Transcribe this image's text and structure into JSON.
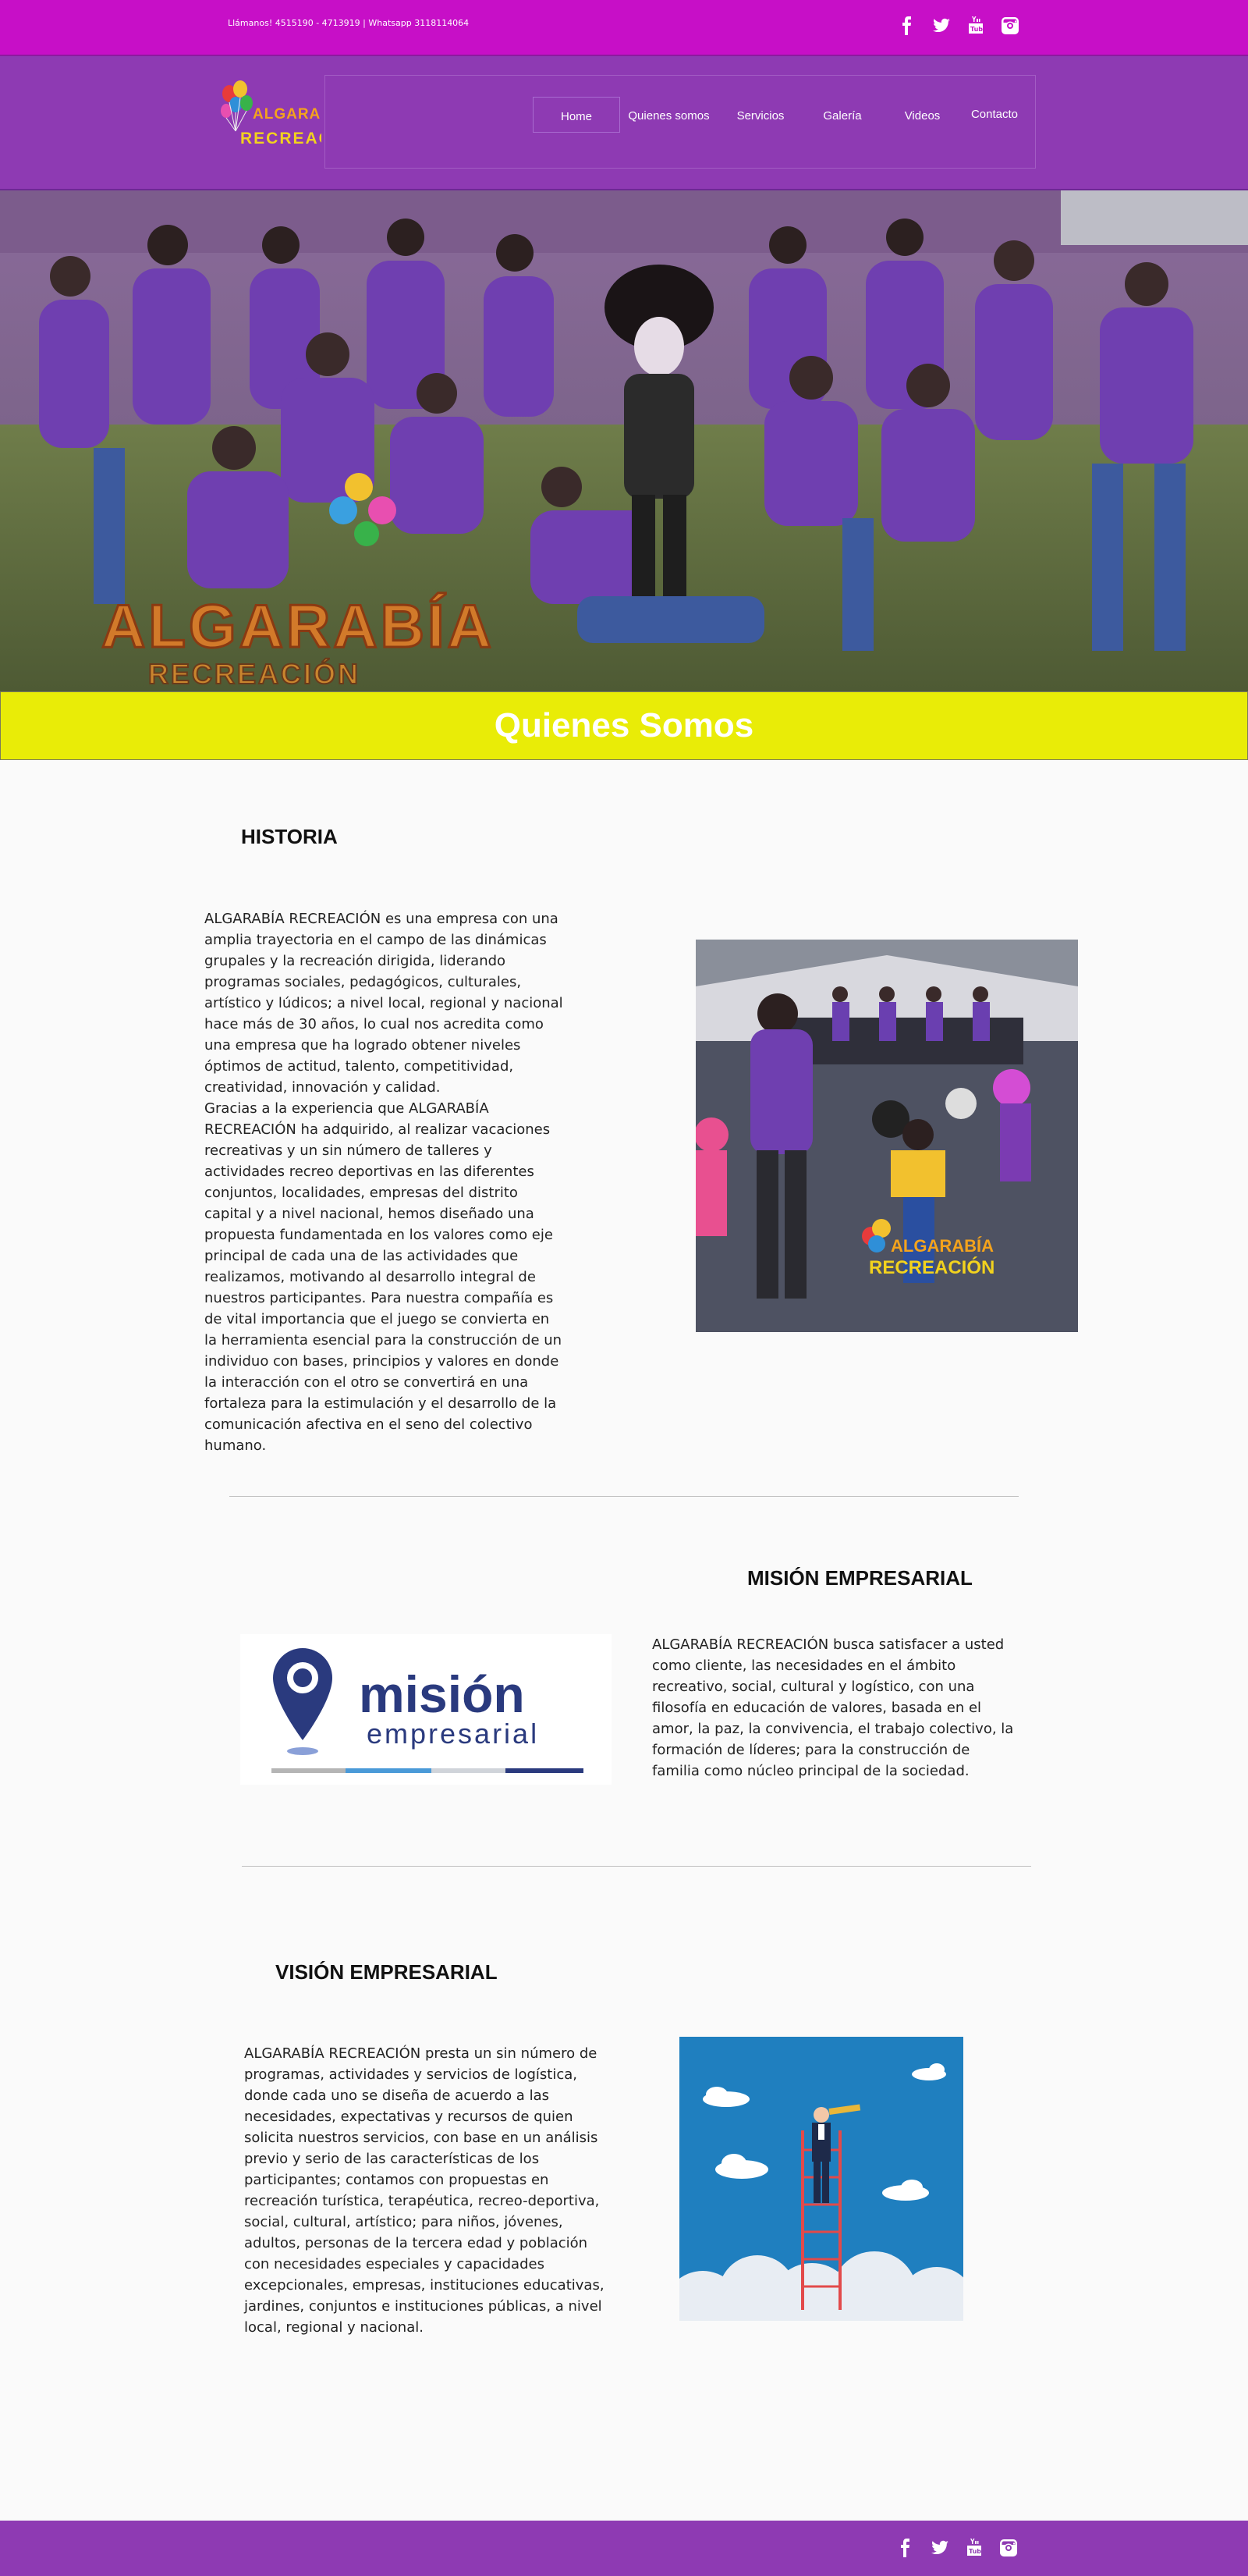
{
  "topbar": {
    "contact": "Llámanos! 4515190 - 4713919 | Whatsapp 3118114064",
    "social": [
      "facebook-icon",
      "twitter-icon",
      "youtube-icon",
      "instagram-icon"
    ]
  },
  "header": {
    "logo_line1": "ALGARABÍA",
    "logo_line2": "RECREACIÓN",
    "nav": [
      "Home",
      "Quienes somos",
      "Servicios",
      "Galería",
      "Videos",
      "Contacto"
    ]
  },
  "hero": {
    "watermark_line1": "ALGARABÍA",
    "watermark_line2": "RECREACIÓN"
  },
  "banner": {
    "title": "Quienes Somos"
  },
  "historia": {
    "title": "HISTORIA",
    "lines": [
      "ALGARABÍA RECREACIÓN es una empresa con una",
      "amplia trayectoria en el campo de las dinámicas",
      "grupales y la recreación dirigida, liderando",
      "programas sociales, pedagógicos, culturales,",
      "artístico y lúdicos; a nivel local, regional y nacional",
      "hace más de 30 años, lo cual nos acredita como",
      "una empresa que ha logrado obtener niveles",
      "óptimos de actitud, talento, competitividad,",
      "creatividad, innovación y calidad.",
      "Gracias a la experiencia que ALGARABÍA",
      "RECREACIÓN ha adquirido, al realizar vacaciones",
      "recreativas y un sin número de talleres y",
      "actividades recreo deportivas en las diferentes",
      "conjuntos, localidades, empresas del distrito",
      "capital y a nivel nacional, hemos diseñado una",
      "propuesta fundamentada en los valores como eje",
      "principal de cada una de las actividades que",
      "realizamos, motivando al desarrollo integral de",
      "nuestros participantes. Para nuestra compañía es",
      "de vital importancia que el juego se convierta en",
      "la herramienta esencial para la construcción de un",
      "individuo con bases, principios y valores en donde",
      "la interacción con el otro se convertirá en una",
      "fortaleza para la estimulación y el desarrollo de la",
      "comunicación afectiva en el seno del colectivo",
      "humano."
    ],
    "photo_logo_line1": "ALGARABÍA",
    "photo_logo_line2": "RECREACIÓN"
  },
  "mision": {
    "title": "MISIÓN EMPRESARIAL",
    "logo_word": "misión",
    "logo_sub": "empresarial",
    "lines": [
      "ALGARABÍA RECREACIÓN busca satisfacer a usted",
      "como cliente, las necesidades en el ámbito",
      "recreativo, social, cultural y logístico, con una",
      "filosofía en educación de valores, basada en el",
      "amor, la paz, la convivencia, el trabajo colectivo, la",
      "formación de líderes; para la construcción de",
      "familia como núcleo principal de la sociedad."
    ]
  },
  "vision": {
    "title": "VISIÓN EMPRESARIAL",
    "lines": [
      "ALGARABÍA RECREACIÓN presta un sin número de",
      "programas, actividades y servicios de logística,",
      "donde cada uno se diseña de acuerdo a las",
      "necesidades, expectativas y recursos de quien",
      "solicita nuestros servicios, con base en un análisis",
      "previo y serio de las características de los",
      "participantes; contamos con propuestas en",
      "recreación turística, terapéutica, recreo-deportiva,",
      "social, cultural, artístico; para niños, jóvenes,",
      "adultos, personas de la tercera edad y población",
      "con necesidades especiales y capacidades",
      "excepcionales, empresas, instituciones educativas,",
      "jardines, conjuntos e instituciones públicas, a nivel",
      "local, regional y nacional."
    ]
  },
  "footer": {
    "social": [
      "facebook-icon",
      "twitter-icon",
      "youtube-icon",
      "instagram-icon"
    ]
  }
}
